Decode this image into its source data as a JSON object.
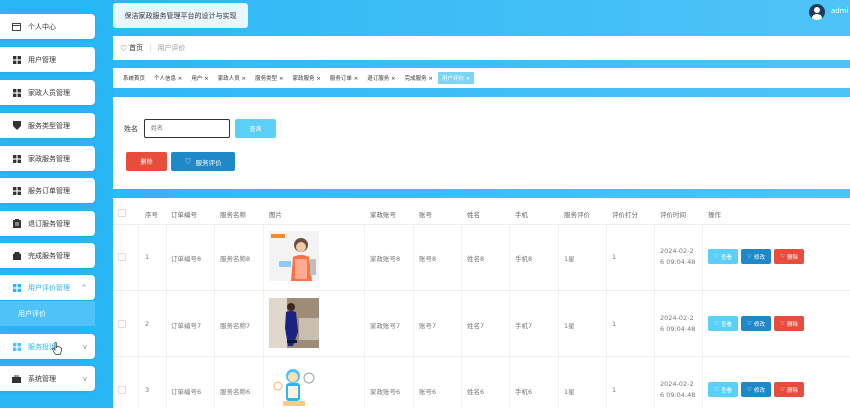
{
  "header": {
    "title": "保洁家政服务管理平台的设计与实现",
    "username": "admi"
  },
  "sidebar": {
    "items": [
      {
        "label": "个人中心",
        "icon": "calendar-icon"
      },
      {
        "label": "用户管理",
        "icon": "grid-icon"
      },
      {
        "label": "家政人员管理",
        "icon": "grid-icon"
      },
      {
        "label": "服务类型管理",
        "icon": "shield-icon"
      },
      {
        "label": "家政服务管理",
        "icon": "grid-icon"
      },
      {
        "label": "服务订单管理",
        "icon": "grid-icon"
      },
      {
        "label": "退订服务管理",
        "icon": "clipboard-icon"
      },
      {
        "label": "完成服务管理",
        "icon": "box-icon"
      },
      {
        "label": "用户评价管理",
        "icon": "grid-icon"
      },
      {
        "label": "服务投诉",
        "icon": "grid-icon"
      },
      {
        "label": "系统管理",
        "icon": "briefcase-icon"
      }
    ],
    "submenu_active": "用户评价"
  },
  "breadcrumb": {
    "home": "首页",
    "current": "用户评价"
  },
  "tags": [
    "系统首页",
    "个人信息",
    "用户",
    "家政人员",
    "服务类型",
    "家政服务",
    "服务订单",
    "退订服务",
    "完成服务",
    "用户评价"
  ],
  "search": {
    "label": "姓名",
    "placeholder": "姓名",
    "query_label": "查询",
    "delete_label": "删除",
    "review_label": "服务评价"
  },
  "table": {
    "headers": [
      "序号",
      "订单编号",
      "服务名称",
      "图片",
      "家政账号",
      "账号",
      "姓名",
      "手机",
      "服务评价",
      "评价打分",
      "评价时间",
      "操作"
    ],
    "rows": [
      {
        "no": "1",
        "order": "订单编号8",
        "service": "服务名称8",
        "staff": "家政账号8",
        "account": "账号8",
        "name": "姓名8",
        "phone": "手机8",
        "review": "1星",
        "score": "1",
        "time1": "2024-02-2",
        "time2": "6 09:04:48"
      },
      {
        "no": "2",
        "order": "订单编号7",
        "service": "服务名称7",
        "staff": "家政账号7",
        "account": "账号7",
        "name": "姓名7",
        "phone": "手机7",
        "review": "1星",
        "score": "1",
        "time1": "2024-02-2",
        "time2": "6 09:04:48"
      },
      {
        "no": "3",
        "order": "订单编号6",
        "service": "服务名称6",
        "staff": "家政账号6",
        "account": "账号6",
        "name": "姓名6",
        "phone": "手机6",
        "review": "1星",
        "score": "1",
        "time1": "2024-02-2",
        "time2": "6 09:04:48"
      }
    ],
    "actions": {
      "view": "查看",
      "edit": "修改",
      "delete": "删除"
    }
  },
  "colors": {
    "primary": "#29b6f6",
    "light": "#5bd0f7",
    "dark": "#1e88c9",
    "danger": "#e74c3c"
  }
}
